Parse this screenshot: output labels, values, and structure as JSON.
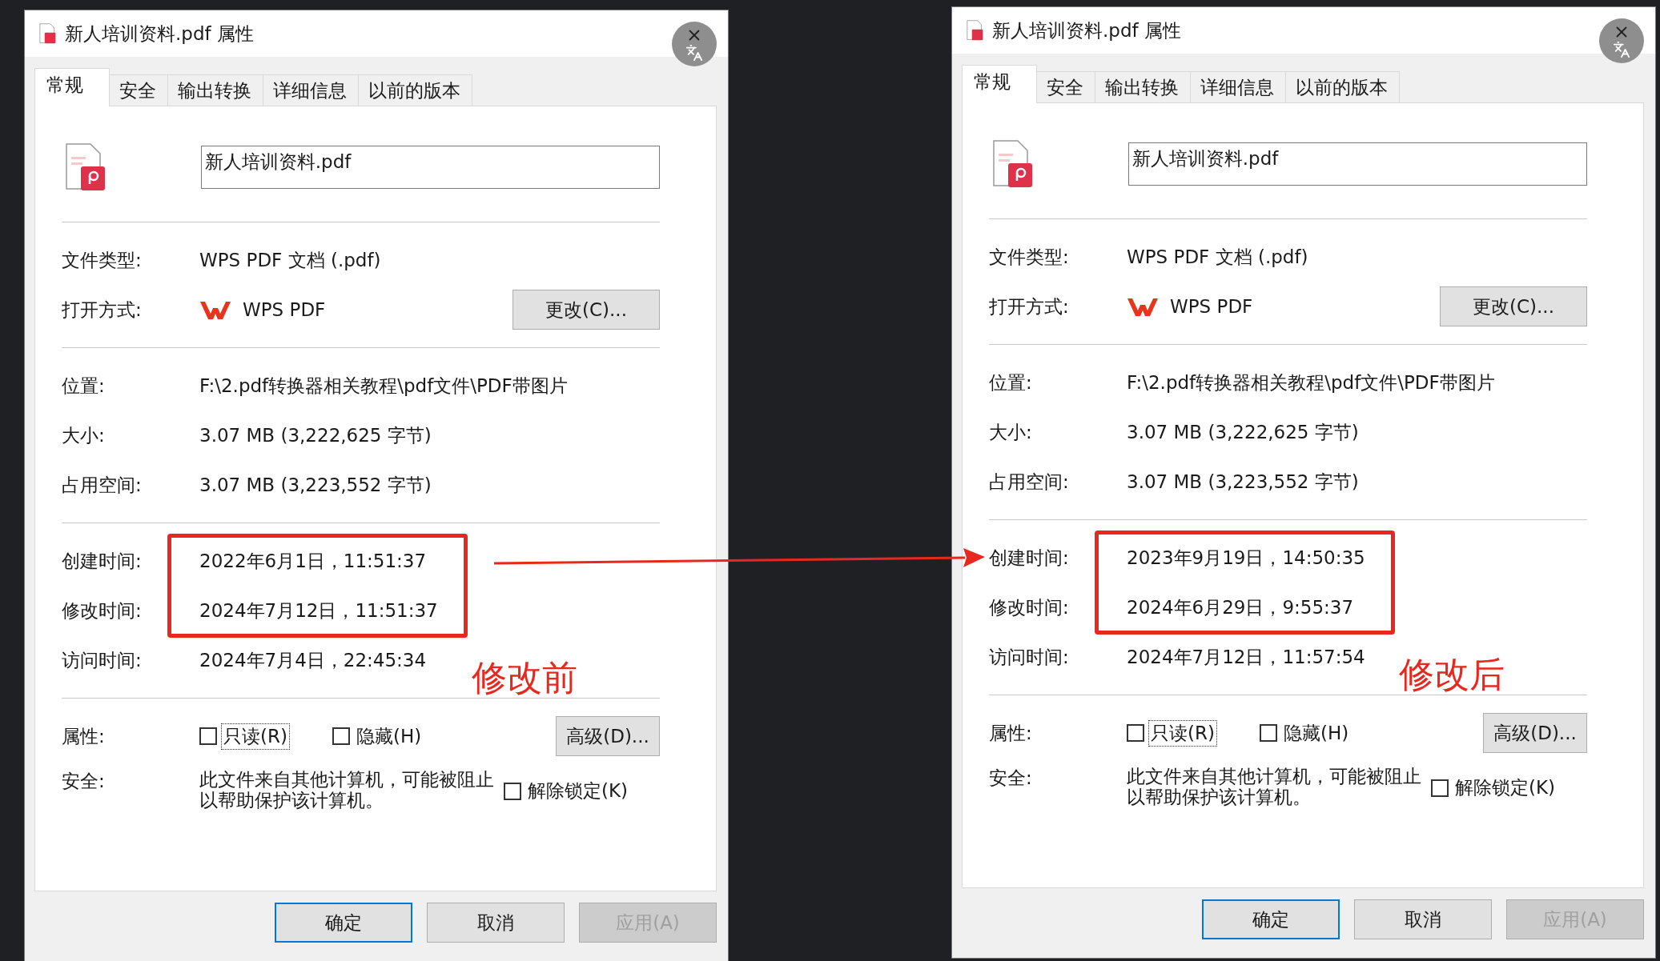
{
  "dialogs": [
    {
      "title": "新人培训资料.pdf 属性",
      "tabs": [
        {
          "label": "常规",
          "selected": true
        },
        {
          "label": "安全",
          "selected": false
        },
        {
          "label": "输出转换",
          "selected": false
        },
        {
          "label": "详细信息",
          "selected": false
        },
        {
          "label": "以前的版本",
          "selected": false
        }
      ],
      "file_name": "新人培训资料.pdf",
      "file_type": {
        "label": "文件类型:",
        "value": "WPS PDF 文档 (.pdf)"
      },
      "open_with": {
        "label": "打开方式:",
        "app": "WPS PDF",
        "button": "更改(C)..."
      },
      "details": [
        {
          "label": "位置:",
          "value": "F:\\2.pdf转换器相关教程\\pdf文件\\PDF带图片"
        },
        {
          "label": "大小:",
          "value": "3.07 MB (3,222,625 字节)"
        },
        {
          "label": "占用空间:",
          "value": "3.07 MB (3,223,552 字节)"
        }
      ],
      "times": [
        {
          "label": "创建时间:",
          "value": "2022年6月1日，11:51:37",
          "highlighted": true
        },
        {
          "label": "修改时间:",
          "value": "2024年7月12日，11:51:37",
          "highlighted": true
        },
        {
          "label": "访问时间:",
          "value": "2024年7月4日，22:45:34",
          "highlighted": false
        }
      ],
      "annotation": "修改前",
      "attributes": {
        "label": "属性:",
        "options": [
          {
            "label": "只读(R)",
            "checked": false,
            "focused": true
          },
          {
            "label": "隐藏(H)",
            "checked": false,
            "focused": false
          }
        ],
        "button": "高级(D)..."
      },
      "security": {
        "label": "安全:",
        "text": "此文件来自其他计算机，可能被阻止以帮助保护该计算机。",
        "unblock": {
          "label": "解除锁定(K)",
          "checked": false
        }
      },
      "buttons": [
        {
          "label": "确定",
          "default": true,
          "disabled": false
        },
        {
          "label": "取消",
          "default": false,
          "disabled": false
        },
        {
          "label": "应用(A)",
          "default": false,
          "disabled": true
        }
      ]
    },
    {
      "title": "新人培训资料.pdf 属性",
      "tabs": [
        {
          "label": "常规",
          "selected": true
        },
        {
          "label": "安全",
          "selected": false
        },
        {
          "label": "输出转换",
          "selected": false
        },
        {
          "label": "详细信息",
          "selected": false
        },
        {
          "label": "以前的版本",
          "selected": false
        }
      ],
      "file_name": "新人培训资料.pdf",
      "file_type": {
        "label": "文件类型:",
        "value": "WPS PDF 文档 (.pdf)"
      },
      "open_with": {
        "label": "打开方式:",
        "app": "WPS PDF",
        "button": "更改(C)..."
      },
      "details": [
        {
          "label": "位置:",
          "value": "F:\\2.pdf转换器相关教程\\pdf文件\\PDF带图片"
        },
        {
          "label": "大小:",
          "value": "3.07 MB (3,222,625 字节)"
        },
        {
          "label": "占用空间:",
          "value": "3.07 MB (3,223,552 字节)"
        }
      ],
      "times": [
        {
          "label": "创建时间:",
          "value": "2023年9月19日，14:50:35",
          "highlighted": true
        },
        {
          "label": "修改时间:",
          "value": "2024年6月29日，9:55:37",
          "highlighted": true
        },
        {
          "label": "访问时间:",
          "value": "2024年7月12日，11:57:54",
          "highlighted": false
        }
      ],
      "annotation": "修改后",
      "attributes": {
        "label": "属性:",
        "options": [
          {
            "label": "只读(R)",
            "checked": false,
            "focused": true
          },
          {
            "label": "隐藏(H)",
            "checked": false,
            "focused": false
          }
        ],
        "button": "高级(D)..."
      },
      "security": {
        "label": "安全:",
        "text": "此文件来自其他计算机，可能被阻止以帮助保护该计算机。",
        "unblock": {
          "label": "解除锁定(K)",
          "checked": false
        }
      },
      "buttons": [
        {
          "label": "确定",
          "default": true,
          "disabled": false
        },
        {
          "label": "取消",
          "default": false,
          "disabled": false
        },
        {
          "label": "应用(A)",
          "default": false,
          "disabled": true
        }
      ]
    }
  ]
}
